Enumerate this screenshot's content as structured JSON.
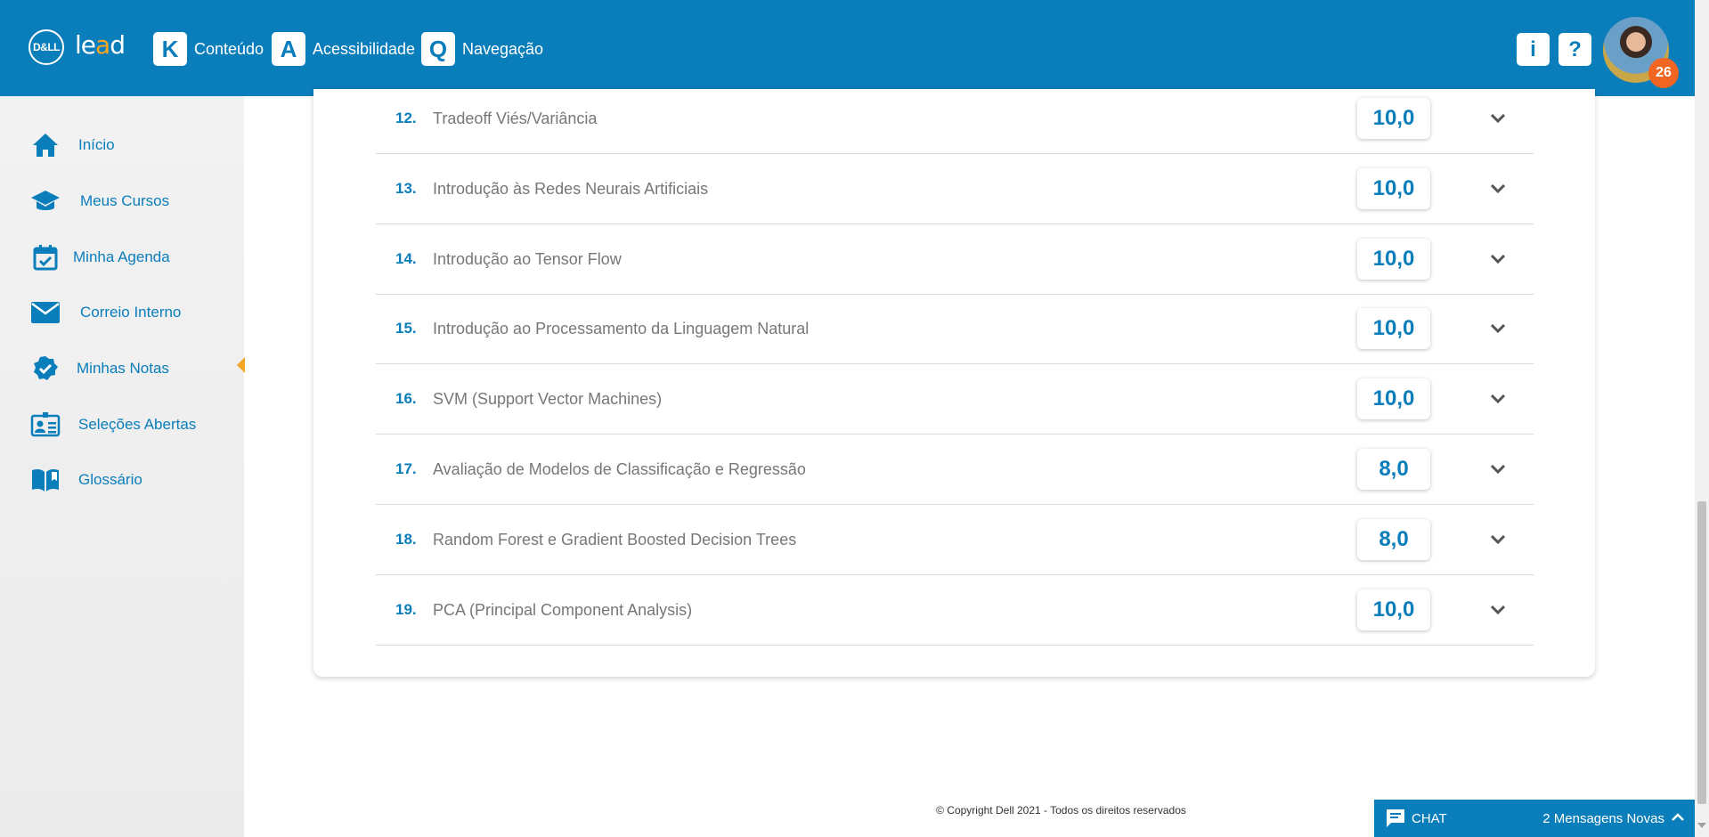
{
  "header": {
    "logo_dell": "D&LL",
    "logo_lead_prefix": "le",
    "logo_lead_o": "a",
    "logo_lead_suffix": "d",
    "shortcuts": [
      {
        "key": "K",
        "label": "Conteúdo"
      },
      {
        "key": "A",
        "label": "Acessibilidade"
      },
      {
        "key": "Q",
        "label": "Navegação"
      }
    ],
    "info_label": "i",
    "help_label": "?",
    "notification_count": "26"
  },
  "sidebar": {
    "items": [
      {
        "label": "Início",
        "icon": "home-icon"
      },
      {
        "label": "Meus Cursos",
        "icon": "graduation-cap-icon"
      },
      {
        "label": "Minha Agenda",
        "icon": "calendar-check-icon"
      },
      {
        "label": "Correio Interno",
        "icon": "envelope-icon"
      },
      {
        "label": "Minhas Notas",
        "icon": "badge-check-icon"
      },
      {
        "label": "Seleções Abertas",
        "icon": "id-card-icon"
      },
      {
        "label": "Glossário",
        "icon": "book-icon"
      }
    ],
    "active": "Minhas Notas"
  },
  "grades": [
    {
      "num": "12.",
      "title": "Tradeoff Viés/Variância",
      "grade": "10,0"
    },
    {
      "num": "13.",
      "title": "Introdução às Redes Neurais Artificiais",
      "grade": "10,0"
    },
    {
      "num": "14.",
      "title": "Introdução ao Tensor Flow",
      "grade": "10,0"
    },
    {
      "num": "15.",
      "title": "Introdução ao Processamento da Linguagem Natural",
      "grade": "10,0"
    },
    {
      "num": "16.",
      "title": "SVM (Support Vector Machines)",
      "grade": "10,0"
    },
    {
      "num": "17.",
      "title": "Avaliação de Modelos de Classificação e Regressão",
      "grade": "8,0"
    },
    {
      "num": "18.",
      "title": "Random Forest e Gradient Boosted Decision Trees",
      "grade": "8,0"
    },
    {
      "num": "19.",
      "title": "PCA (Principal Component Analysis)",
      "grade": "10,0"
    }
  ],
  "footer": {
    "copyright": "© Copyright Dell 2021 - Todos os direitos reservados"
  },
  "chat": {
    "label": "CHAT",
    "new_messages": "2 Mensagens Novas"
  },
  "colors": {
    "primary": "#0a7dbb",
    "accent": "#f5a623",
    "badge": "#f06522"
  }
}
